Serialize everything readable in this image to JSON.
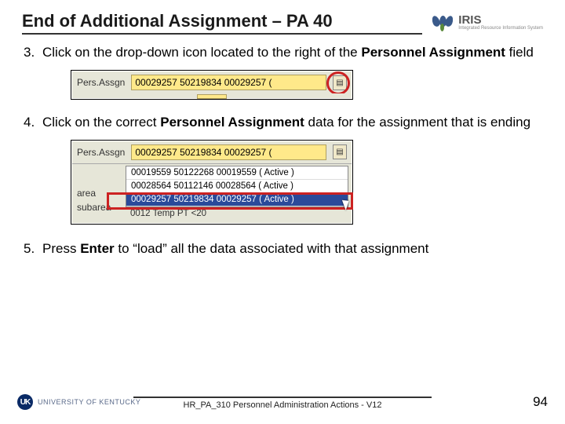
{
  "header": {
    "title": "End of Additional Assignment – PA 40",
    "iris_main": "IRIS",
    "iris_sub": "Integrated Resource Information System"
  },
  "steps": {
    "s3": {
      "num": "3.",
      "pre": "Click on the drop-down icon located to the right of the ",
      "bold": "Personnel Assignment",
      "post": " field"
    },
    "s4": {
      "num": "4.",
      "pre": "Click on the correct ",
      "bold": "Personnel Assignment",
      "post": " data for the assignment that is ending"
    },
    "s5": {
      "num": "5.",
      "pre": "Press ",
      "bold": "Enter",
      "post": " to “load” all the data associated with that assignment"
    }
  },
  "sap": {
    "label": "Pers.Assgn",
    "value": "00029257 50219834 00029257 (",
    "dropdown_glyph": "▤"
  },
  "list": {
    "left_rows": [
      "area",
      "subarea"
    ],
    "items": [
      "00019559 50122268 00019559 ( Active )",
      "00028564 50112146 00028564 ( Active )",
      "00029257 50219834 00029257 ( Active )"
    ],
    "below": "0012   Temp PT <20",
    "selected_index": 2
  },
  "footer": {
    "uk_badge": "UK",
    "uk_text": "UNIVERSITY OF KENTUCKY",
    "center": "HR_PA_310 Personnel Administration Actions - V12",
    "page": "94"
  }
}
